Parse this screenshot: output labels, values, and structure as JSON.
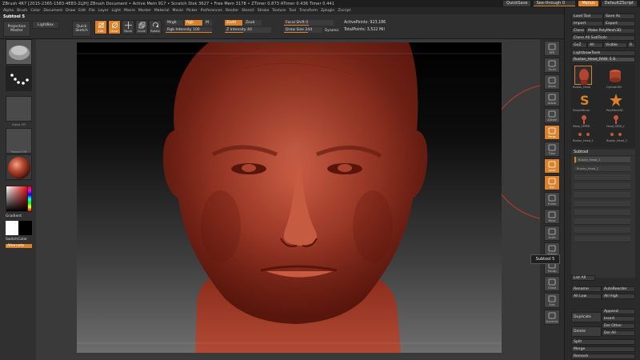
{
  "titlebar": {
    "title": "ZBrush 4R7 [2015-2365-1583-4E83-2LJH]   ZBrush Document   • Active Mem 917 • Scratch Disk 3627 • Free Mem 3178 • ZTimer 0.873 ATimer 0.436  Timer 0.441",
    "quicksave": "QuickSave",
    "seethrough": "See-through 0",
    "menus": "Menus",
    "script": "DefaultZScript"
  },
  "menubar": [
    "Alpha",
    "Brush",
    "Color",
    "Document",
    "Draw",
    "Edit",
    "File",
    "Layer",
    "Light",
    "Macro",
    "Marker",
    "Material",
    "Movie",
    "Picker",
    "Preferences",
    "Render",
    "Stencil",
    "Stroke",
    "Texture",
    "Tool",
    "Transform",
    "Zplugin",
    "Zscript"
  ],
  "shelf": {
    "subtool_title": "Subtool 5",
    "projection_master": "Projection Master",
    "lightbox": "LightBox",
    "quick_sketch": "Quick Sketch",
    "tools": [
      {
        "label": "Edit",
        "icon": "edit-icon",
        "active": true
      },
      {
        "label": "Draw",
        "icon": "draw-icon",
        "active": true
      },
      {
        "label": "Move",
        "icon": "move-icon",
        "active": false
      },
      {
        "label": "Scale",
        "icon": "scale-icon",
        "active": false
      },
      {
        "label": "Rotate",
        "icon": "rotate-icon",
        "active": false
      }
    ],
    "mrgb": "Mrgb",
    "rgb": "Rgb",
    "m": "M",
    "zadd": "Zadd",
    "zsub": "Zsub",
    "rgb_intensity": "Rgb Intensity 100",
    "z_intensity": "Z Intensity 40",
    "focal_shift": "Focal Shift 0",
    "draw_size": "Draw Size 244",
    "dynamic": "Dynamic",
    "active_points": "ActivePoints: 923,186",
    "total_points": "TotalPoints: 3,522 Mil"
  },
  "lefttray": {
    "gradient": "Gradient",
    "switchcolor": "SwitchColor",
    "alternate": "Alternate",
    "thumbs": [
      "Alpha Off",
      "Texture Off"
    ]
  },
  "righttools": [
    "BPR",
    "Scroll",
    "Zoom",
    "Actual",
    "AAHalf",
    "Persp",
    "Floor",
    "Local",
    "Xyz",
    "Frame",
    "Move",
    "Scale",
    "Rotate",
    "Transp",
    "Ghost",
    "Solo",
    "Dynamic"
  ],
  "rightpanel": {
    "load_tool": "Load Tool",
    "save_as": "Save As",
    "import": "Import",
    "export": "Export",
    "clone": "Clone",
    "make_polymesh": "Make PolyMesh3D",
    "clone_all": "Clone All SubTools",
    "goz": "GoZ",
    "all": "All",
    "visible": "Visible",
    "r": "R",
    "lightbox_tools": "Lightbox▸Tools",
    "current_tool": "Ruslan_Head_RAW. 5 8",
    "tools": [
      "Ruslan_Head",
      "Cylinder3D",
      "SimpleBrush",
      "PolyMesh3D",
      "Mask_UPPER",
      "Head_SEMI_2",
      "Ruslan_Head_2",
      "Ruslan_Head_3"
    ],
    "subtool": "Subtool",
    "subtool_items": [
      "Ruslan_Head_1",
      "Ruslan_Head_2",
      "",
      "",
      "",
      "",
      "",
      "",
      "",
      ""
    ],
    "list_all": "List All",
    "rename": "Rename",
    "autoreorder": "AutoReorder",
    "all_low": "All Low",
    "all_high": "All High",
    "duplicate": "Duplicate",
    "append": "Append",
    "insert": "Insert",
    "delete": "Delete",
    "del_other": "Del Other",
    "del_all": "Del All",
    "split": "Split",
    "merge": "Merge",
    "remesh": "Remesh"
  },
  "tooltip": "Subtool 5",
  "colors": {
    "accent": "#d9822b",
    "panel": "#2a2a2a",
    "clay": "#b4452e"
  }
}
